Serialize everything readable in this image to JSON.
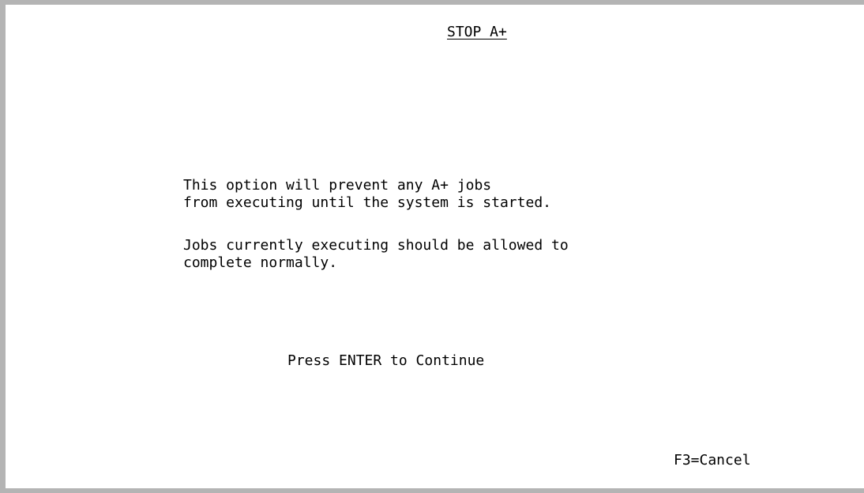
{
  "screen": {
    "title": "STOP A+",
    "message": {
      "line1": "This option will prevent any A+ jobs",
      "line2": "from executing until the system is started.",
      "line3": "Jobs currently executing should be allowed to",
      "line4": "complete normally."
    },
    "prompt": "Press ENTER to Continue",
    "function_keys": {
      "cancel": "F3=Cancel"
    }
  }
}
